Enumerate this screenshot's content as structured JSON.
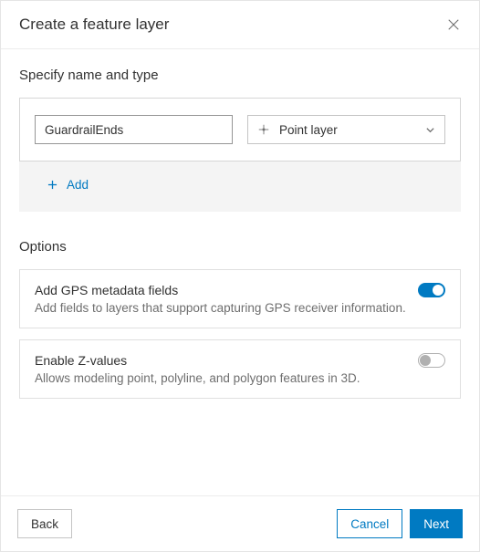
{
  "dialog": {
    "title": "Create a feature layer"
  },
  "spec": {
    "section_title": "Specify name and type",
    "name_value": "GuardrailEnds",
    "type_label": "Point layer",
    "add_label": "Add"
  },
  "options": {
    "section_title": "Options",
    "gps": {
      "title": "Add GPS metadata fields",
      "desc": "Add fields to layers that support capturing GPS receiver information.",
      "enabled": true
    },
    "z": {
      "title": "Enable Z-values",
      "desc": "Allows modeling point, polyline, and polygon features in 3D.",
      "enabled": false
    }
  },
  "footer": {
    "back": "Back",
    "cancel": "Cancel",
    "next": "Next"
  }
}
